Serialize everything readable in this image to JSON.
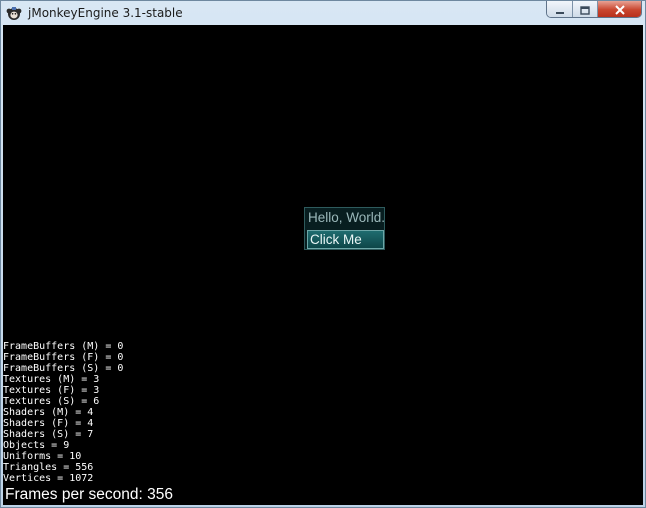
{
  "window": {
    "title": "jMonkeyEngine 3.1-stable",
    "icon": "jmonkey-app-icon",
    "controls": [
      "minimize",
      "maximize",
      "close"
    ]
  },
  "gui": {
    "label": "Hello, World.",
    "button_label": "Click Me"
  },
  "stats": [
    "FrameBuffers (M) = 0",
    "FrameBuffers (F) = 0",
    "FrameBuffers (S) = 0",
    "Textures (M) = 3",
    "Textures (F) = 3",
    "Textures (S) = 6",
    "Shaders (M) = 4",
    "Shaders (F) = 4",
    "Shaders (S) = 7",
    "Objects = 9",
    "Uniforms = 10",
    "Triangles = 556",
    "Vertices = 1072"
  ],
  "fps": "Frames per second: 356",
  "colors": {
    "viewport_background": "#000000",
    "gui_text": "#9bb8ba",
    "button_fill": "#1f6c6f",
    "close_button": "#c9462f"
  }
}
